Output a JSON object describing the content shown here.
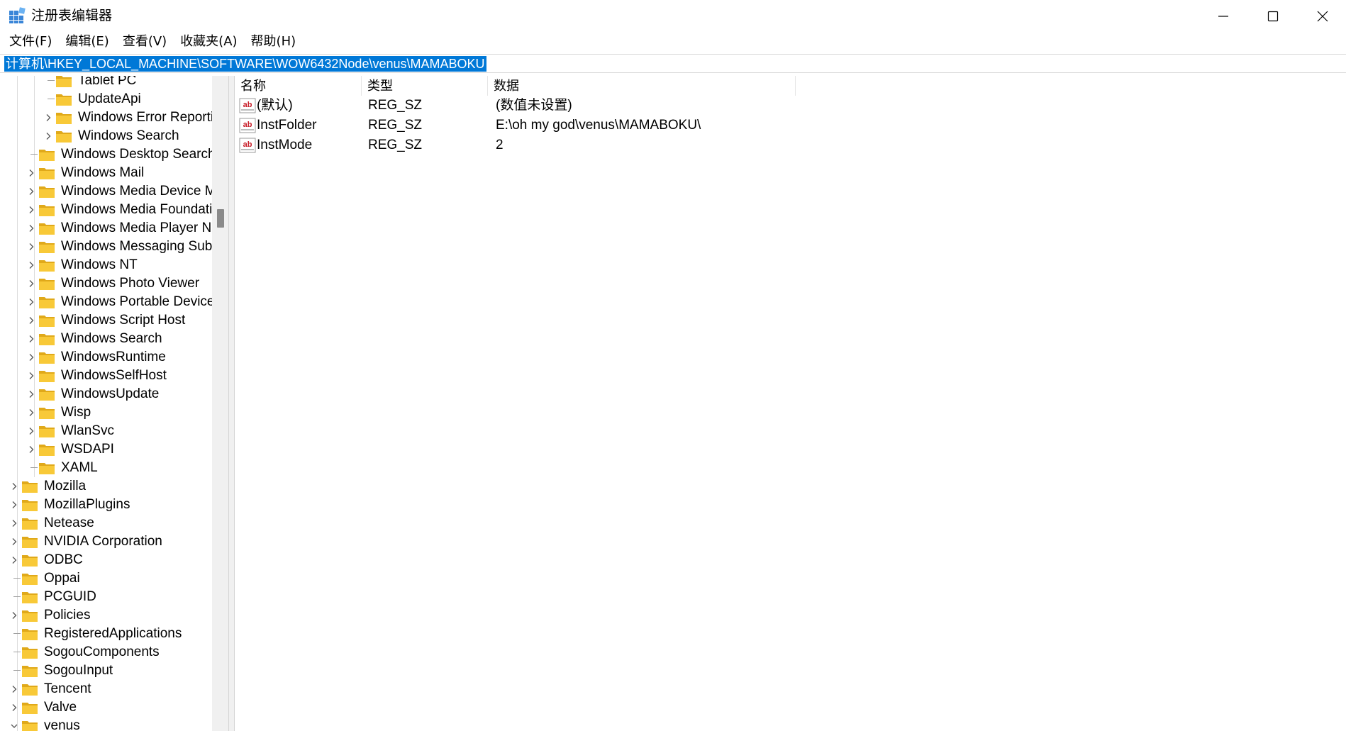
{
  "window": {
    "title": "注册表编辑器",
    "minimize_icon": "minimize-icon",
    "maximize_icon": "maximize-icon",
    "close_icon": "close-icon"
  },
  "menu": [
    {
      "label": "文件(F)"
    },
    {
      "label": "编辑(E)"
    },
    {
      "label": "查看(V)"
    },
    {
      "label": "收藏夹(A)"
    },
    {
      "label": "帮助(H)"
    }
  ],
  "address": {
    "path": "计算机\\HKEY_LOCAL_MACHINE\\SOFTWARE\\WOW6432Node\\venus\\MAMABOKU"
  },
  "tree": [
    {
      "label": "Tablet PC",
      "depth": 2,
      "expandable": false
    },
    {
      "label": "UpdateApi",
      "depth": 2,
      "expandable": false
    },
    {
      "label": "Windows Error Reporting",
      "depth": 2,
      "expandable": true
    },
    {
      "label": "Windows Search",
      "depth": 2,
      "expandable": true
    },
    {
      "label": "Windows Desktop Search",
      "depth": 1,
      "expandable": false
    },
    {
      "label": "Windows Mail",
      "depth": 1,
      "expandable": true
    },
    {
      "label": "Windows Media Device Manager",
      "depth": 1,
      "expandable": true
    },
    {
      "label": "Windows Media Foundation",
      "depth": 1,
      "expandable": true
    },
    {
      "label": "Windows Media Player NSS",
      "depth": 1,
      "expandable": true
    },
    {
      "label": "Windows Messaging Subsystem",
      "depth": 1,
      "expandable": true
    },
    {
      "label": "Windows NT",
      "depth": 1,
      "expandable": true
    },
    {
      "label": "Windows Photo Viewer",
      "depth": 1,
      "expandable": true
    },
    {
      "label": "Windows Portable Devices",
      "depth": 1,
      "expandable": true
    },
    {
      "label": "Windows Script Host",
      "depth": 1,
      "expandable": true
    },
    {
      "label": "Windows Search",
      "depth": 1,
      "expandable": true
    },
    {
      "label": "WindowsRuntime",
      "depth": 1,
      "expandable": true
    },
    {
      "label": "WindowsSelfHost",
      "depth": 1,
      "expandable": true
    },
    {
      "label": "WindowsUpdate",
      "depth": 1,
      "expandable": true
    },
    {
      "label": "Wisp",
      "depth": 1,
      "expandable": true
    },
    {
      "label": "WlanSvc",
      "depth": 1,
      "expandable": true
    },
    {
      "label": "WSDAPI",
      "depth": 1,
      "expandable": true
    },
    {
      "label": "XAML",
      "depth": 1,
      "expandable": false
    },
    {
      "label": "Mozilla",
      "depth": 0,
      "expandable": true
    },
    {
      "label": "MozillaPlugins",
      "depth": 0,
      "expandable": true
    },
    {
      "label": "Netease",
      "depth": 0,
      "expandable": true
    },
    {
      "label": "NVIDIA Corporation",
      "depth": 0,
      "expandable": true
    },
    {
      "label": "ODBC",
      "depth": 0,
      "expandable": true
    },
    {
      "label": "Oppai",
      "depth": 0,
      "expandable": false
    },
    {
      "label": "PCGUID",
      "depth": 0,
      "expandable": false
    },
    {
      "label": "Policies",
      "depth": 0,
      "expandable": true
    },
    {
      "label": "RegisteredApplications",
      "depth": 0,
      "expandable": false
    },
    {
      "label": "SogouComponents",
      "depth": 0,
      "expandable": false
    },
    {
      "label": "SogouInput",
      "depth": 0,
      "expandable": false
    },
    {
      "label": "Tencent",
      "depth": 0,
      "expandable": true
    },
    {
      "label": "Valve",
      "depth": 0,
      "expandable": true
    },
    {
      "label": "venus",
      "depth": 0,
      "expandable": true,
      "expanded": true
    }
  ],
  "list": {
    "columns": [
      {
        "label": "名称"
      },
      {
        "label": "类型"
      },
      {
        "label": "数据"
      }
    ],
    "rows": [
      {
        "name": "(默认)",
        "type": "REG_SZ",
        "data": "(数值未设置)",
        "icon": "string-value-icon"
      },
      {
        "name": "InstFolder",
        "type": "REG_SZ",
        "data": "E:\\oh my god\\venus\\MAMABOKU\\",
        "icon": "string-value-icon"
      },
      {
        "name": "InstMode",
        "type": "REG_SZ",
        "data": "2",
        "icon": "string-value-icon"
      }
    ]
  },
  "colors": {
    "selection": "#0078d7",
    "folder": "#f8c938",
    "folder_dark": "#e0a91a",
    "chrome": "#f0f0f0"
  }
}
